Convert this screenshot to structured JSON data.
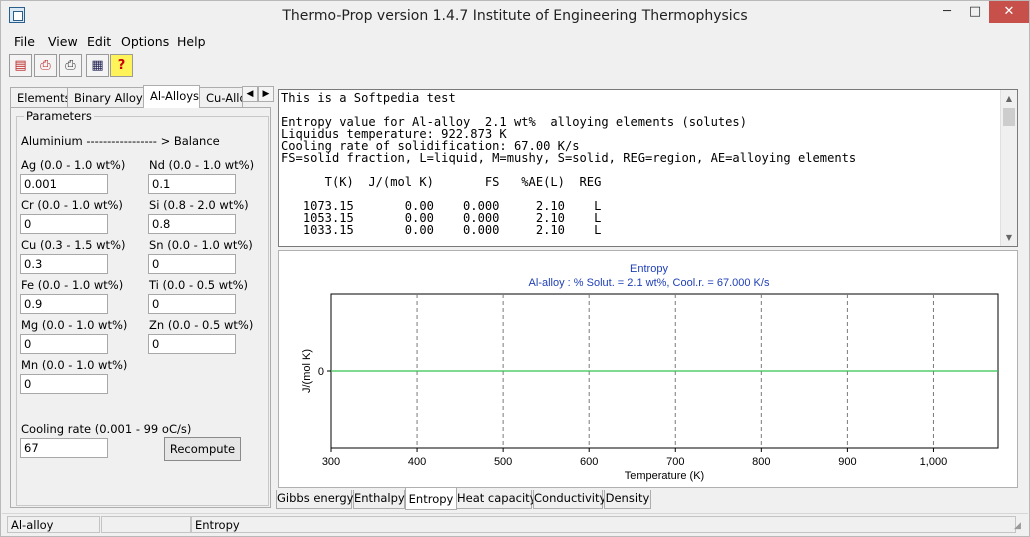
{
  "window": {
    "title": "Thermo-Prop version 1.4.7  Institute of Engineering Thermophysics",
    "minimize_icon": "─",
    "maximize_icon": "□",
    "close_icon": "✕"
  },
  "menu": [
    "File",
    "View",
    "Edit",
    "Options",
    "Help"
  ],
  "toolbar": {
    "icons": [
      "document-icon",
      "open-icon",
      "print-icon",
      "calculator-icon",
      "help-icon"
    ],
    "glyphs": [
      "▤",
      "⎙",
      "⎙",
      "▦",
      "?"
    ]
  },
  "left_tabs": {
    "items": [
      "Elements",
      "Binary Alloys",
      "Al-Alloys",
      "Cu-Allo"
    ],
    "active": "Al-Alloys",
    "arrow_left": "◀",
    "arrow_right": "▶"
  },
  "params": {
    "legend": "Parameters",
    "balance": "Aluminium ----------------- > Balance",
    "fields": [
      {
        "label": "Ag (0.0 - 1.0 wt%)",
        "value": "0.001"
      },
      {
        "label": "Nd (0.0 - 1.0 wt%)",
        "value": "0.1"
      },
      {
        "label": "Cr (0.0 - 1.0 wt%)",
        "value": "0"
      },
      {
        "label": "Si (0.8 - 2.0 wt%)",
        "value": "0.8"
      },
      {
        "label": "Cu (0.3 - 1.5 wt%)",
        "value": "0.3"
      },
      {
        "label": "Sn (0.0 - 1.0 wt%)",
        "value": "0"
      },
      {
        "label": "Fe (0.0 - 1.0 wt%)",
        "value": "0.9"
      },
      {
        "label": "Ti (0.0 - 0.5 wt%)",
        "value": "0"
      },
      {
        "label": "Mg (0.0 - 1.0 wt%)",
        "value": "0"
      },
      {
        "label": "Zn (0.0 - 0.5 wt%)",
        "value": "0"
      },
      {
        "label": "Mn (0.0 - 1.0 wt%)",
        "value": "0"
      }
    ],
    "cooling_label": "Cooling rate (0.001 - 99 oC/s)",
    "cooling_value": "67",
    "recompute_label": "Recompute"
  },
  "output": {
    "lines": [
      "This is a Softpedia test",
      "",
      "Entropy value for Al-alloy  2.1 wt%  alloying elements (solutes)",
      "Liquidus temperature: 922.873 K",
      "Cooling rate of solidification: 67.00 K/s",
      "FS=solid fraction, L=liquid, M=mushy, S=solid, REG=region, AE=alloying elements",
      "",
      "      T(K)  J/(mol K)       FS   %AE(L)  REG",
      "",
      "   1073.15       0.00    0.000     2.10    L",
      "   1053.15       0.00    0.000     2.10    L",
      "   1033.15       0.00    0.000     2.10    L"
    ],
    "scroll_up": "▲",
    "scroll_down": "▼"
  },
  "chart_data": {
    "type": "line",
    "title": "Entropy",
    "subtitle": "Al-alloy : % Solut. =  2.1  wt%, Cool.r. = 67.000 K/s",
    "xlabel": "Temperature (K)",
    "ylabel": "J/(mol K)",
    "xlim": [
      300,
      1075
    ],
    "x_ticks": [
      300,
      400,
      500,
      600,
      700,
      800,
      900,
      1000
    ],
    "x_tick_labels": [
      "300",
      "400",
      "500",
      "600",
      "700",
      "800",
      "900",
      "1,000"
    ],
    "y_ticks": [
      0
    ],
    "y_tick_labels": [
      "0"
    ],
    "grid": "vertical dashed",
    "series": [
      {
        "x": [
          300,
          1075
        ],
        "y": [
          0,
          0
        ],
        "color": "#33c24d"
      }
    ],
    "title_color": "#1f3fb5"
  },
  "bottom_tabs": {
    "items": [
      "Gibbs energy",
      "Enthalpy",
      "Entropy",
      "Heat capacity",
      "Conductivity",
      "Density"
    ],
    "active": "Entropy"
  },
  "status": {
    "left": "Al-alloy",
    "middle": "",
    "right": "Entropy"
  }
}
